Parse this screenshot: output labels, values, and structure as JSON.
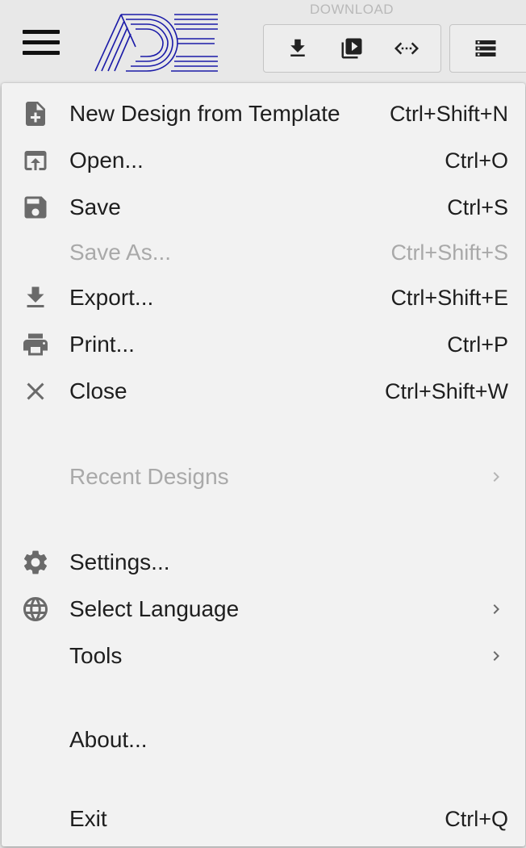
{
  "toolbar": {
    "download_label": "DOWNLOAD",
    "accent_color": "#1a1aa8"
  },
  "menu": {
    "items": [
      {
        "label": "New Design from Template",
        "shortcut": "Ctrl+Shift+N",
        "icon": "note-add-icon",
        "enabled": true
      },
      {
        "label": "Open...",
        "shortcut": "Ctrl+O",
        "icon": "open-upload-icon",
        "enabled": true
      },
      {
        "label": "Save",
        "shortcut": "Ctrl+S",
        "icon": "save-icon",
        "enabled": true
      },
      {
        "label": "Save As...",
        "shortcut": "Ctrl+Shift+S",
        "icon": "",
        "enabled": false
      },
      {
        "label": "Export...",
        "shortcut": "Ctrl+Shift+E",
        "icon": "download-icon",
        "enabled": true
      },
      {
        "label": "Print...",
        "shortcut": "Ctrl+P",
        "icon": "print-icon",
        "enabled": true
      },
      {
        "label": "Close",
        "shortcut": "Ctrl+Shift+W",
        "icon": "close-icon",
        "enabled": true
      },
      {
        "label": "Recent Designs",
        "submenu": true,
        "icon": "",
        "enabled": false
      },
      {
        "label": "Settings...",
        "shortcut": "",
        "icon": "gear-icon",
        "enabled": true
      },
      {
        "label": "Select Language",
        "submenu": true,
        "icon": "globe-icon",
        "enabled": true
      },
      {
        "label": "Tools",
        "submenu": true,
        "icon": "",
        "enabled": true
      },
      {
        "label": "About...",
        "shortcut": "",
        "icon": "",
        "enabled": true
      },
      {
        "label": "Exit",
        "shortcut": "Ctrl+Q",
        "icon": "",
        "enabled": true
      }
    ]
  }
}
